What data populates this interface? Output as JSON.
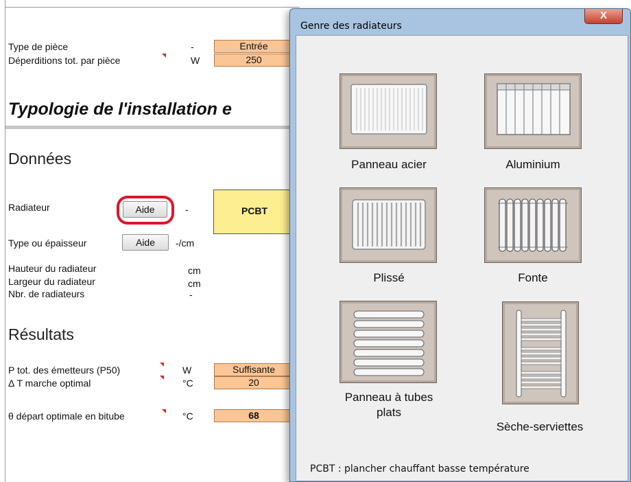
{
  "sheet": {
    "rows_top": [
      {
        "label": "Type de pièce",
        "unit": "-",
        "value": "Entrée"
      },
      {
        "label": "Déperditions tot. par pièce",
        "unit": "W",
        "value": "250"
      }
    ],
    "title": "Typologie de l'installation e",
    "section_donnees": "Données",
    "radiateur": {
      "label": "Radiateur",
      "button": "Aide",
      "unit": "-",
      "value": "PCBT"
    },
    "type_epaisseur": {
      "label": "Type ou épaisseur",
      "button": "Aide",
      "unit": "-/cm"
    },
    "dims": [
      {
        "label": "Hauteur du radiateur",
        "unit": "cm"
      },
      {
        "label": "Largeur du radiateur",
        "unit": "cm"
      },
      {
        "label": "Nbr. de radiateurs",
        "unit": "-"
      }
    ],
    "section_resultats": "Résultats",
    "results": [
      {
        "label": "P tot. des émetteurs (P50)",
        "unit": "W",
        "value": "Suffisante"
      },
      {
        "label": "Δ T marche optimal",
        "unit": "°C",
        "value": "20"
      },
      {
        "label": "θ départ optimale en bitube",
        "unit": "°C",
        "value": "68"
      }
    ]
  },
  "dialog": {
    "title": "Genre des radiateurs",
    "close_label": "X",
    "options": [
      {
        "label": "Panneau acier",
        "icon": "steel-panel-radiator-icon"
      },
      {
        "label": "Aluminium",
        "icon": "aluminium-radiator-icon"
      },
      {
        "label": "Plissé",
        "icon": "pleated-radiator-icon"
      },
      {
        "label": "Fonte",
        "icon": "cast-iron-radiator-icon"
      },
      {
        "label_line1": "Panneau à tubes",
        "label_line2": "plats",
        "icon": "flat-tube-radiator-icon"
      },
      {
        "label": "Sèche-serviettes",
        "icon": "towel-dryer-icon"
      }
    ],
    "footer": "PCBT : plancher chauffant basse température"
  },
  "colors": {
    "input_cell": "#fbc695",
    "selected_cell": "#fdee8f",
    "highlight_ring": "#e0152c",
    "dialog_frame": "#a9c4e0"
  }
}
